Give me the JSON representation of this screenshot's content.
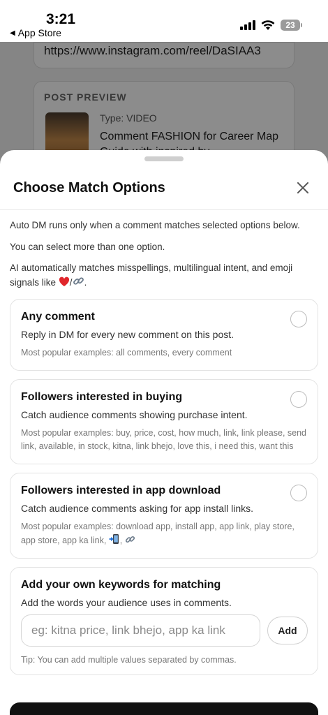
{
  "status_bar": {
    "time": "3:21",
    "back_label": "App Store",
    "battery": "23"
  },
  "background": {
    "url_value": "https://www.instagram.com/reel/DaSIAA3",
    "preview_label": "POST PREVIEW",
    "post_type": "Type: VIDEO",
    "post_caption": "Comment FASHION for Career Map Guide with inspired by"
  },
  "sheet": {
    "title": "Choose Match Options",
    "intro_1": "Auto DM runs only when a comment matches selected options below.",
    "intro_2": "You can select more than one option.",
    "intro_3": "AI automatically matches misspellings, multilingual intent, and emoji signals like",
    "intro_3_suffix": ".",
    "options": [
      {
        "title": "Any comment",
        "desc": "Reply in DM for every new comment on this post.",
        "examples": "Most popular examples: all comments, every comment"
      },
      {
        "title": "Followers interested in buying",
        "desc": "Catch audience comments showing purchase intent.",
        "examples": "Most popular examples: buy, price, cost, how much, link, link please, send link, available, in stock, kitna, link bhejo, love this, i need this, want this"
      },
      {
        "title": "Followers interested in app download",
        "desc": "Catch audience comments asking for app install links.",
        "examples": "Most popular examples: download app, install app, app link, play store, app store, app ka link,"
      }
    ],
    "custom": {
      "title": "Add your own keywords for matching",
      "desc": "Add the words your audience uses in comments.",
      "placeholder": "eg: kitna price, link bhejo, app ka link",
      "add_label": "Add",
      "tip": "Tip: You can add multiple values separated by commas."
    }
  },
  "colors": {
    "overlay": "#000000",
    "heart": "#e0262b",
    "link_icon": "#6b7a8a"
  }
}
